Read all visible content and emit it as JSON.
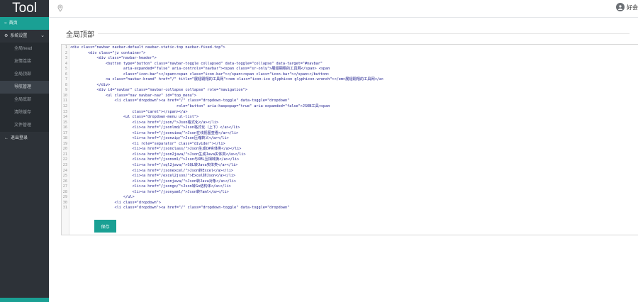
{
  "app": {
    "title": "Tool"
  },
  "sidebar": {
    "items": [
      {
        "label": "首页",
        "icon": "circle-icon",
        "active": true
      },
      {
        "label": "系统设置",
        "icon": "gear-icon",
        "expanded": true
      }
    ],
    "sub_items": [
      {
        "label": "全局head"
      },
      {
        "label": "友情连接"
      },
      {
        "label": "全局顶部"
      },
      {
        "label": "导航管理",
        "current": true
      },
      {
        "label": "全局底部"
      },
      {
        "label": "清除缓存"
      },
      {
        "label": "文件管理"
      }
    ],
    "logout": {
      "label": "退出登录",
      "icon": "arrow-left-icon"
    }
  },
  "topbar": {
    "location_icon": "map-pin-icon",
    "user_name": "好会"
  },
  "panel": {
    "title": "全局顶部"
  },
  "editor": {
    "lines": [
      "<div class=\"navbar navbar-default navbar-static-top navbar-fixed-top\">",
      "        <div class=\"jz container\">",
      "            <div class=\"navbar-header\">",
      "                <button type=\"button\" class=\"navbar-toggle collapsed\" data-toggle=\"collapse\" data-target=\"#navbar\"",
      "                        aria-expanded=\"false\" aria-controls=\"navbar\"><span class=\"sr-only\">展翅翱翔的工具网</span> <span",
      "                        class=\"icon-bar\"></span><span class=\"icon-bar\"></span><span class=\"icon-bar\"></span></button>",
      "                <a class=\"navbar-brand\" href=\"/\" title=\"展翅翱翔的工具网\"><em class=\"icon-ico glyphicon glyphicon-wrench\"></em>展翅翱翔的工具网</a>",
      "            </div>",
      "            <div id=\"navbar\" class=\"navbar-collapse collapse\" role=\"navigation\">",
      "                <ul class=\"nav navbar-nav\" id=\"top_menu\">",
      "                    <li class=\"dropdown\"><a href=\"/\" class=\"dropdown-toggle\" data-toggle=\"dropdown\"",
      "                                                role=\"button\" aria-haspopup=\"true\" aria-expanded=\"false\">JSON工具<span",
      "                            class=\"caret\"></span></a>",
      "                        <ul class=\"dropdown-menu ul-list\">",
      "                            <li><a href=\"/json/\">Json格式化</a></li>",
      "                            <li><a href=\"/jsonlmd/\">Json格式化（上下）</a></li>",
      "                            <li><a href=\"/jsonview/\">Json在线视图查看</a></li>",
      "                            <li><a href=\"/jsonzip/\">Json压缩转义</a></li>",
      "                            <li role=\"separator\" class=\"divider\"></li>",
      "                            <li><a href=\"/jsonclass/\">Json生成C#实体类</a></li>",
      "                            <li><a href=\"/json2java/\">Json生成Java实体类</a></li>",
      "                            <li><a href=\"/jsonxml/\">Json与XML互相转换</a></li>",
      "                            <li><a href=\"/sql2java/\">SQL转Java实体类</a></li>",
      "                            <li><a href=\"/jsonexcel/\">Json转Excel</a></li>",
      "                            <li><a href=\"/excel2json/\">Excel转Json</a></li>",
      "                            <li><a href=\"/jsonjava/\">Json转Java对象</a></li>",
      "                            <li><a href=\"/jsongo/\">Json转Go结构体</a></li>",
      "                            <li><a href=\"/jsonyaml/\">Json转Yaml</a></li>",
      "                        </ul>",
      "                    <li class=\"dropdown\">",
      "                    <li class=\"dropdown\"><a href=\"/\" class=\"dropdown-toggle\" data-toggle=\"dropdown\""
    ]
  },
  "actions": {
    "save_label": "保存"
  },
  "colors": {
    "sidebar": "#2d3238",
    "accent": "#1aa094",
    "background": "#f0f2f5"
  }
}
